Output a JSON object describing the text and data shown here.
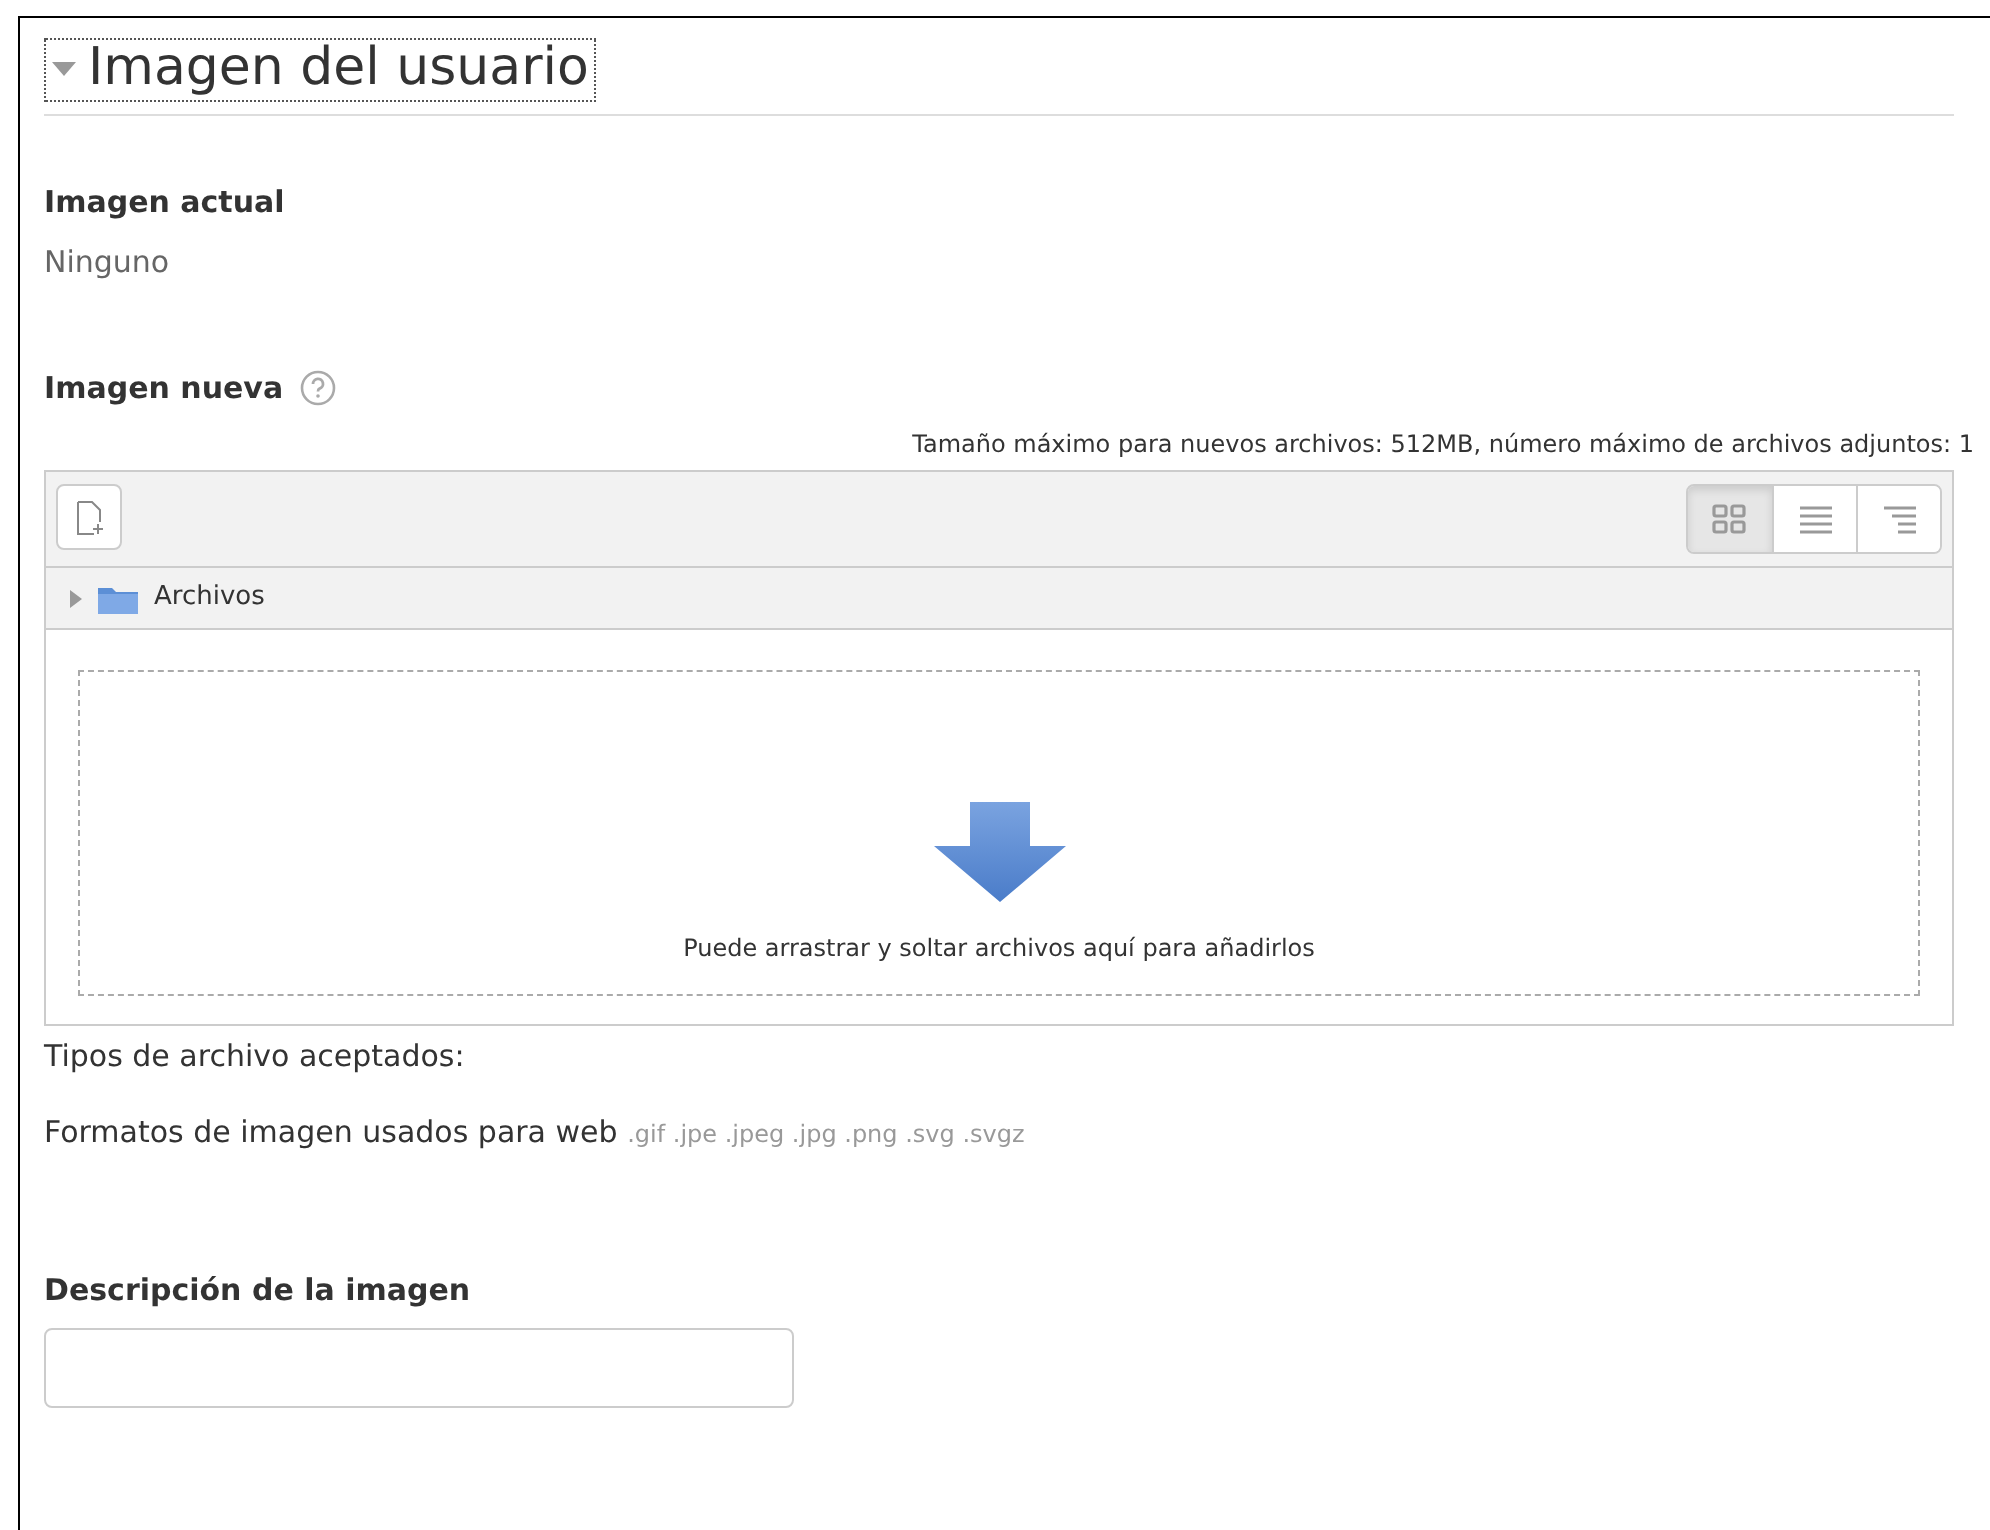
{
  "section": {
    "title": "Imagen del usuario",
    "expanded": true
  },
  "current_image": {
    "label": "Imagen actual",
    "value": "Ninguno"
  },
  "new_image": {
    "label": "Imagen nueva",
    "limits": "Tamaño máximo para nuevos archivos: 512MB, número máximo de archivos adjuntos: 1",
    "view_modes": [
      {
        "kind": "icons",
        "selected": true
      },
      {
        "kind": "list",
        "selected": false
      },
      {
        "kind": "tree",
        "selected": false
      }
    ],
    "path": "Archivos",
    "drop_hint": "Puede arrastrar y soltar archivos aquí para añadirlos"
  },
  "accepted": {
    "label": "Tipos de archivo aceptados:",
    "type_name": "Formatos de imagen usados para web",
    "extensions": ".gif .jpe .jpeg .jpg .png .svg .svgz"
  },
  "description": {
    "label": "Descripción de la imagen"
  }
}
